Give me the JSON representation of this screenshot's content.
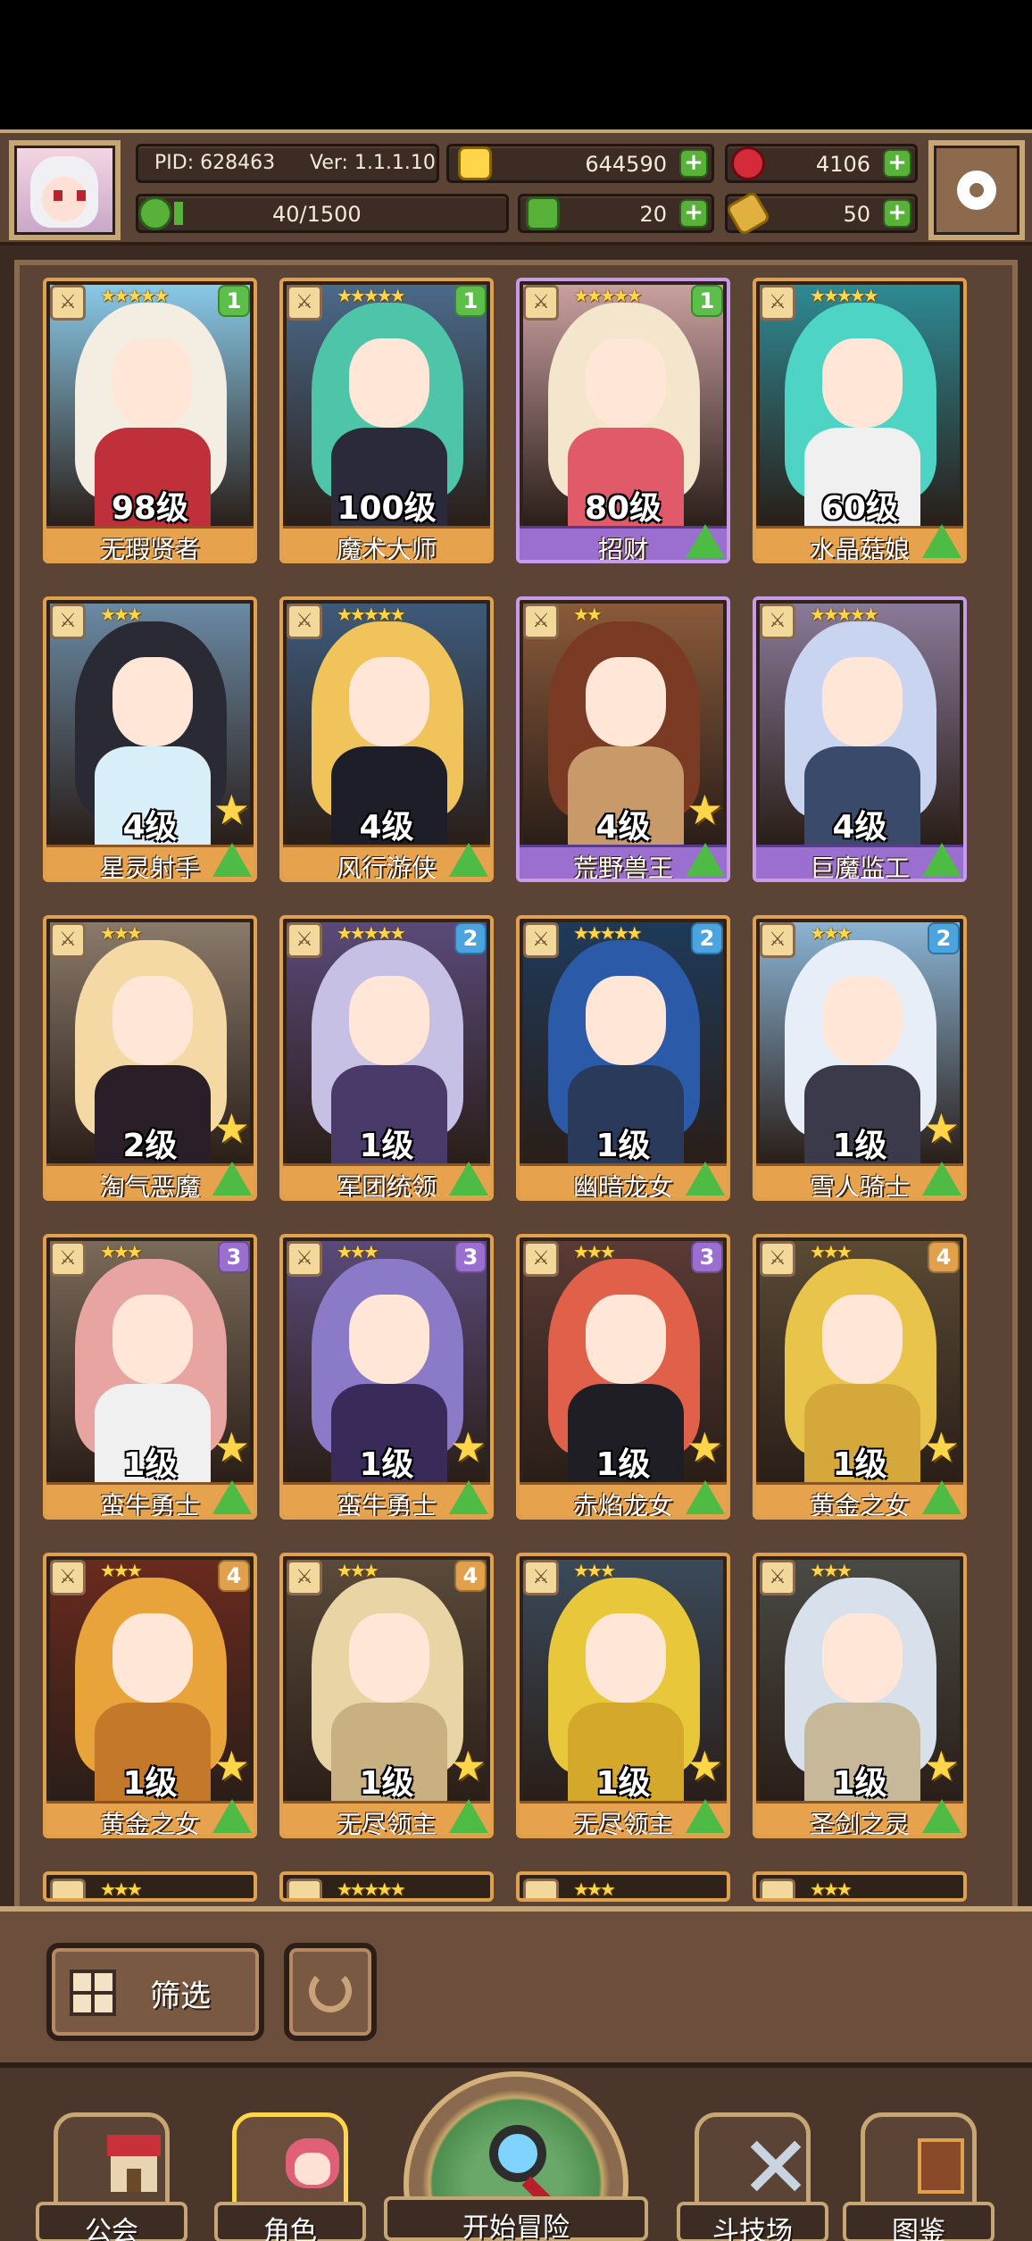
{
  "header": {
    "pid": "PID: 628463",
    "version": "Ver: 1.1.1.10",
    "gold": "644590",
    "gems": "4106",
    "stamina": "40/1500",
    "stamina_progress": 0.027,
    "clover": "20",
    "keys": "50"
  },
  "cards": [
    {
      "name": "无瑕贤者",
      "level": "98级",
      "badge": "1",
      "badge_color": "#5cbf4a",
      "stars": "★★★★★",
      "frame": "gold",
      "hair": "#f4ede2",
      "body": "#c0303a",
      "bg": "#89c9e8",
      "star_icon": false,
      "tree_icon": false
    },
    {
      "name": "魔术大师",
      "level": "100级",
      "badge": "1",
      "badge_color": "#5cbf4a",
      "stars": "★★★★★",
      "frame": "gold",
      "hair": "#4ec5a8",
      "body": "#2a2a3a",
      "bg": "#4a6a8a",
      "star_icon": false,
      "tree_icon": false
    },
    {
      "name": "招财",
      "level": "80级",
      "badge": "1",
      "badge_color": "#5cbf4a",
      "stars": "★★★★★",
      "frame": "purple",
      "hair": "#f3e6cc",
      "body": "#e05a6a",
      "bg": "#c9a0a0",
      "star_icon": false,
      "tree_icon": true
    },
    {
      "name": "水晶菇娘",
      "level": "60级",
      "badge": "",
      "badge_color": "",
      "stars": "★★★★★",
      "frame": "gold",
      "hair": "#4ed4c4",
      "body": "#f0f0f0",
      "bg": "#2e8a94",
      "star_icon": false,
      "tree_icon": true
    },
    {
      "name": "星灵射手",
      "level": "4级",
      "badge": "",
      "badge_color": "",
      "stars": "★★★",
      "frame": "gold",
      "hair": "#2a2a34",
      "body": "#d8eef8",
      "bg": "#6a8aa4",
      "star_icon": true,
      "tree_icon": true
    },
    {
      "name": "风行游侠",
      "level": "4级",
      "badge": "",
      "badge_color": "",
      "stars": "★★★★★",
      "frame": "gold",
      "hair": "#f0c45a",
      "body": "#1e1e28",
      "bg": "#3e5a7a",
      "star_icon": false,
      "tree_icon": true
    },
    {
      "name": "荒野兽王",
      "level": "4级",
      "badge": "",
      "badge_color": "",
      "stars": "★★",
      "frame": "purple",
      "hair": "#7a3a24",
      "body": "#c89a6a",
      "bg": "#8a5a3a",
      "star_icon": true,
      "tree_icon": true
    },
    {
      "name": "巨魔监工",
      "level": "4级",
      "badge": "",
      "badge_color": "",
      "stars": "★★★★★",
      "frame": "purple",
      "hair": "#c8d4f0",
      "body": "#3a4a6a",
      "bg": "#8a7a9a",
      "star_icon": false,
      "tree_icon": true
    },
    {
      "name": "淘气恶魔",
      "level": "2级",
      "badge": "",
      "badge_color": "",
      "stars": "★★★",
      "frame": "gold",
      "hair": "#f4d9a4",
      "body": "#2a1e28",
      "bg": "#8a7a6a",
      "star_icon": true,
      "tree_icon": true
    },
    {
      "name": "军团统领",
      "level": "1级",
      "badge": "2",
      "badge_color": "#4aa4e0",
      "stars": "★★★★★",
      "frame": "gold",
      "hair": "#c6c0e4",
      "body": "#4a3a6a",
      "bg": "#5a4a7a",
      "star_icon": false,
      "tree_icon": true
    },
    {
      "name": "幽暗龙女",
      "level": "1级",
      "badge": "2",
      "badge_color": "#4aa4e0",
      "stars": "★★★★★",
      "frame": "gold",
      "hair": "#2a5aa8",
      "body": "#2a3a5a",
      "bg": "#1e3a5a",
      "star_icon": false,
      "tree_icon": true
    },
    {
      "name": "雪人骑士",
      "level": "1级",
      "badge": "2",
      "badge_color": "#4aa4e0",
      "stars": "★★★",
      "frame": "gold",
      "hair": "#e8eef8",
      "body": "#3a3a4a",
      "bg": "#8ab4d4",
      "star_icon": true,
      "tree_icon": true
    },
    {
      "name": "蛮牛勇士",
      "level": "1级",
      "badge": "3",
      "badge_color": "#9a6fcf",
      "stars": "★★★",
      "frame": "gold",
      "hair": "#e8a4a0",
      "body": "#f0f0f0",
      "bg": "#7a6a5a",
      "star_icon": true,
      "tree_icon": true
    },
    {
      "name": "蛮牛勇士",
      "level": "1级",
      "badge": "3",
      "badge_color": "#9a6fcf",
      "stars": "★★★",
      "frame": "gold",
      "hair": "#8a7ac8",
      "body": "#3a2a5a",
      "bg": "#5a4a7a",
      "star_icon": true,
      "tree_icon": true
    },
    {
      "name": "赤焰龙女",
      "level": "1级",
      "badge": "3",
      "badge_color": "#9a6fcf",
      "stars": "★★★",
      "frame": "gold",
      "hair": "#e0604a",
      "body": "#1e1e24",
      "bg": "#5a3a34",
      "star_icon": true,
      "tree_icon": true
    },
    {
      "name": "黄金之女",
      "level": "1级",
      "badge": "4",
      "badge_color": "#e0a04c",
      "stars": "★★★",
      "frame": "gold",
      "hair": "#e8c44a",
      "body": "#d4a83a",
      "bg": "#5a4a34",
      "star_icon": true,
      "tree_icon": true
    },
    {
      "name": "黄金之女",
      "level": "1级",
      "badge": "4",
      "badge_color": "#e0a04c",
      "stars": "★★★",
      "frame": "gold",
      "hair": "#e8a43a",
      "body": "#c4782a",
      "bg": "#6a2a1e",
      "star_icon": true,
      "tree_icon": true
    },
    {
      "name": "无尽领主",
      "level": "1级",
      "badge": "4",
      "badge_color": "#e0a04c",
      "stars": "★★★",
      "frame": "gold",
      "hair": "#e8d4a4",
      "body": "#c8b080",
      "bg": "#5a4a3a",
      "star_icon": true,
      "tree_icon": true
    },
    {
      "name": "无尽领主",
      "level": "1级",
      "badge": "",
      "badge_color": "",
      "stars": "★★★",
      "frame": "gold",
      "hair": "#e8c83a",
      "body": "#d4a82a",
      "bg": "#3a4a5a",
      "star_icon": true,
      "tree_icon": true
    },
    {
      "name": "圣剑之灵",
      "level": "1级",
      "badge": "",
      "badge_color": "",
      "stars": "★★★",
      "frame": "gold",
      "hair": "#d8e0ec",
      "body": "#c8b89a",
      "bg": "#4a4a44",
      "star_icon": true,
      "tree_icon": true
    }
  ],
  "partial_cards": [
    {
      "stars": "★★★",
      "frame": "gold"
    },
    {
      "stars": "★★★★★",
      "frame": "gold"
    },
    {
      "stars": "★★★",
      "frame": "gold"
    },
    {
      "stars": "★★★",
      "frame": "gold"
    }
  ],
  "filter": {
    "label": "筛选"
  },
  "nav": {
    "guild": "公会",
    "characters": "角色",
    "start_adventure": "开始冒险",
    "arena": "斗技场",
    "codex": "图鉴"
  },
  "colors": {
    "frame_gold": "#e0a04c",
    "frame_purple": "#c79be8",
    "name_bar_gold": "#e6a24c",
    "name_bar_purple": "#9a6fcf",
    "panel": "#5b4336",
    "plus_green": "#58b23a"
  }
}
